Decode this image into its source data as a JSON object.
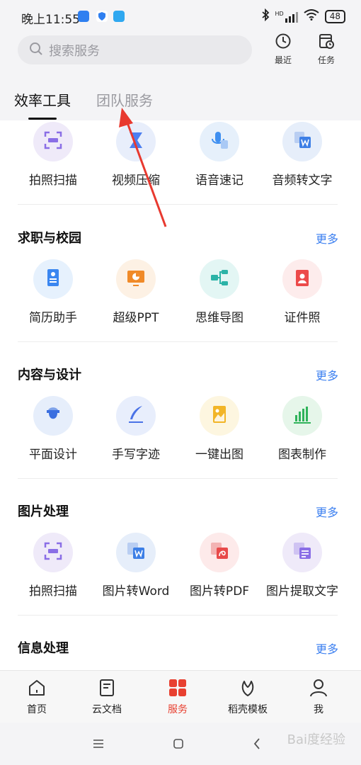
{
  "status_bar": {
    "time": "晚上11:55",
    "battery": "48",
    "network_label": "HD"
  },
  "search": {
    "placeholder": "搜索服务"
  },
  "top_actions": [
    {
      "label": "最近",
      "icon": "clock-icon"
    },
    {
      "label": "任务",
      "icon": "task-calendar-icon"
    }
  ],
  "tabs": [
    {
      "label": "效率工具",
      "active": true
    },
    {
      "label": "团队服务",
      "active": false
    }
  ],
  "row0": [
    {
      "label": "拍照扫描",
      "icon": "scan-icon",
      "bg": "#efeaf9",
      "fg": "#8a6ee6"
    },
    {
      "label": "视频压缩",
      "icon": "video-compress-icon",
      "bg": "#e8eefb",
      "fg": "#4d7ff0"
    },
    {
      "label": "语音速记",
      "icon": "microphone-icon",
      "bg": "#e6f0fb",
      "fg": "#3f8ff0"
    },
    {
      "label": "音频转文字",
      "icon": "audio-to-text-icon",
      "bg": "#e6eefa",
      "fg": "#3d7fe6"
    }
  ],
  "sections": [
    {
      "title": "求职与校园",
      "more": "更多",
      "items": [
        {
          "label": "简历助手",
          "icon": "resume-icon",
          "bg": "#e6f1fd",
          "fg": "#3a86f0"
        },
        {
          "label": "超级PPT",
          "icon": "ppt-icon",
          "bg": "#fdf1e4",
          "fg": "#f08a28"
        },
        {
          "label": "思维导图",
          "icon": "mindmap-icon",
          "bg": "#e3f6f4",
          "fg": "#2bb3a7"
        },
        {
          "label": "证件照",
          "icon": "id-photo-icon",
          "bg": "#fdecec",
          "fg": "#ec4a4a"
        }
      ]
    },
    {
      "title": "内容与设计",
      "more": "更多",
      "items": [
        {
          "label": "平面设计",
          "icon": "design-icon",
          "bg": "#e6eefb",
          "fg": "#3b6fe0"
        },
        {
          "label": "手写字迹",
          "icon": "pen-icon",
          "bg": "#e8eefc",
          "fg": "#4a72e6"
        },
        {
          "label": "一键出图",
          "icon": "image-gen-icon",
          "bg": "#fdf6e0",
          "fg": "#f2b527"
        },
        {
          "label": "图表制作",
          "icon": "chart-icon",
          "bg": "#e6f6ea",
          "fg": "#2fb35a"
        }
      ]
    },
    {
      "title": "图片处理",
      "more": "更多",
      "items": [
        {
          "label": "拍照扫描",
          "icon": "scan-icon",
          "bg": "#efeaf9",
          "fg": "#8a6ee6"
        },
        {
          "label": "图片转Word",
          "icon": "image-to-word-icon",
          "bg": "#e6eefa",
          "fg": "#3d7fe6"
        },
        {
          "label": "图片转PDF",
          "icon": "image-to-pdf-icon",
          "bg": "#fdeaea",
          "fg": "#e84a4a"
        },
        {
          "label": "图片提取文字",
          "icon": "extract-text-icon",
          "bg": "#efeaf9",
          "fg": "#8a6ee6"
        }
      ]
    },
    {
      "title": "信息处理",
      "more": "更多",
      "items": []
    }
  ],
  "bottom_nav": [
    {
      "label": "首页",
      "icon": "home-icon",
      "active": false
    },
    {
      "label": "云文档",
      "icon": "document-icon",
      "active": false
    },
    {
      "label": "服务",
      "icon": "grid-icon",
      "active": true
    },
    {
      "label": "稻壳模板",
      "icon": "leaf-icon",
      "active": false
    },
    {
      "label": "我",
      "icon": "user-icon",
      "active": false
    }
  ],
  "watermark": "Bai度经验",
  "colors": {
    "accent": "#e84030",
    "link": "#3b7ff0",
    "arrow": "#e8392f"
  }
}
